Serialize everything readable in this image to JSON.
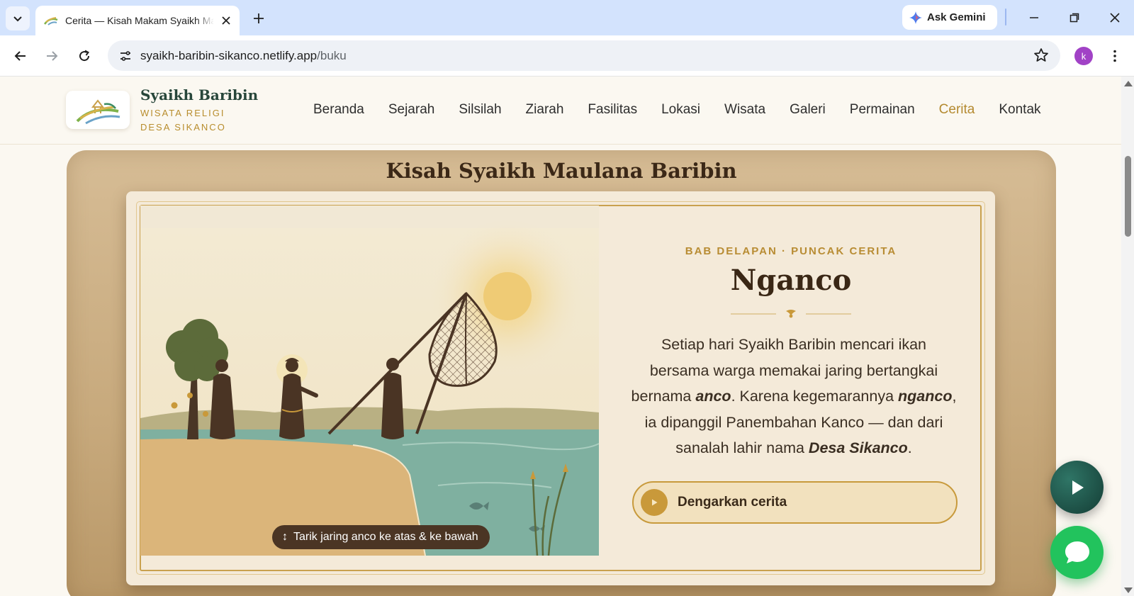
{
  "browser": {
    "tab_title": "Cerita — Kisah Makam Syaikh Maulana Baribin",
    "new_tab_icon": "plus-icon",
    "ask_gemini_label": "Ask Gemini",
    "url_domain": "syaikh-baribin-sikanco.netlify.app",
    "url_path": "/buku",
    "profile_initial": "k",
    "colors": {
      "tab_strip": "#d3e3fd",
      "profile": "#a142c6"
    }
  },
  "site": {
    "brand_name": "Syaikh Baribin",
    "brand_sub_1": "WISATA RELIGI",
    "brand_sub_2": "DESA SIKANCO",
    "nav": [
      {
        "label": "Beranda",
        "active": false
      },
      {
        "label": "Sejarah",
        "active": false
      },
      {
        "label": "Silsilah",
        "active": false
      },
      {
        "label": "Ziarah",
        "active": false
      },
      {
        "label": "Fasilitas",
        "active": false
      },
      {
        "label": "Lokasi",
        "active": false
      },
      {
        "label": "Wisata",
        "active": false
      },
      {
        "label": "Galeri",
        "active": false
      },
      {
        "label": "Permainan",
        "active": false
      },
      {
        "label": "Cerita",
        "active": true
      },
      {
        "label": "Kontak",
        "active": false
      }
    ],
    "colors": {
      "accent": "#b48a30",
      "brand": "#27463a"
    }
  },
  "book": {
    "title": "Kisah Syaikh Maulana Baribin",
    "drag_hint": "Tarik jaring anco ke atas & ke bawah",
    "chapter": "BAB DELAPAN · PUNCAK CERITA",
    "story_title": "Nganco",
    "text": {
      "p1": "Setiap hari Syaikh Baribin mencari ikan bersama warga memakai jaring bertangkai bernama ",
      "em1": "anco",
      "p2": ". Karena kegemarannya ",
      "em2": "nganco",
      "p3": ", ia dipanggil Panembahan Kanco — dan dari sanalah lahir nama ",
      "em3": "Desa Sikanco",
      "p4": "."
    },
    "listen_label": "Dengarkan cerita"
  },
  "floating": {
    "play_icon": "play-icon",
    "chat_icon": "chat-bubble-icon",
    "chat_color": "#22c35d"
  }
}
